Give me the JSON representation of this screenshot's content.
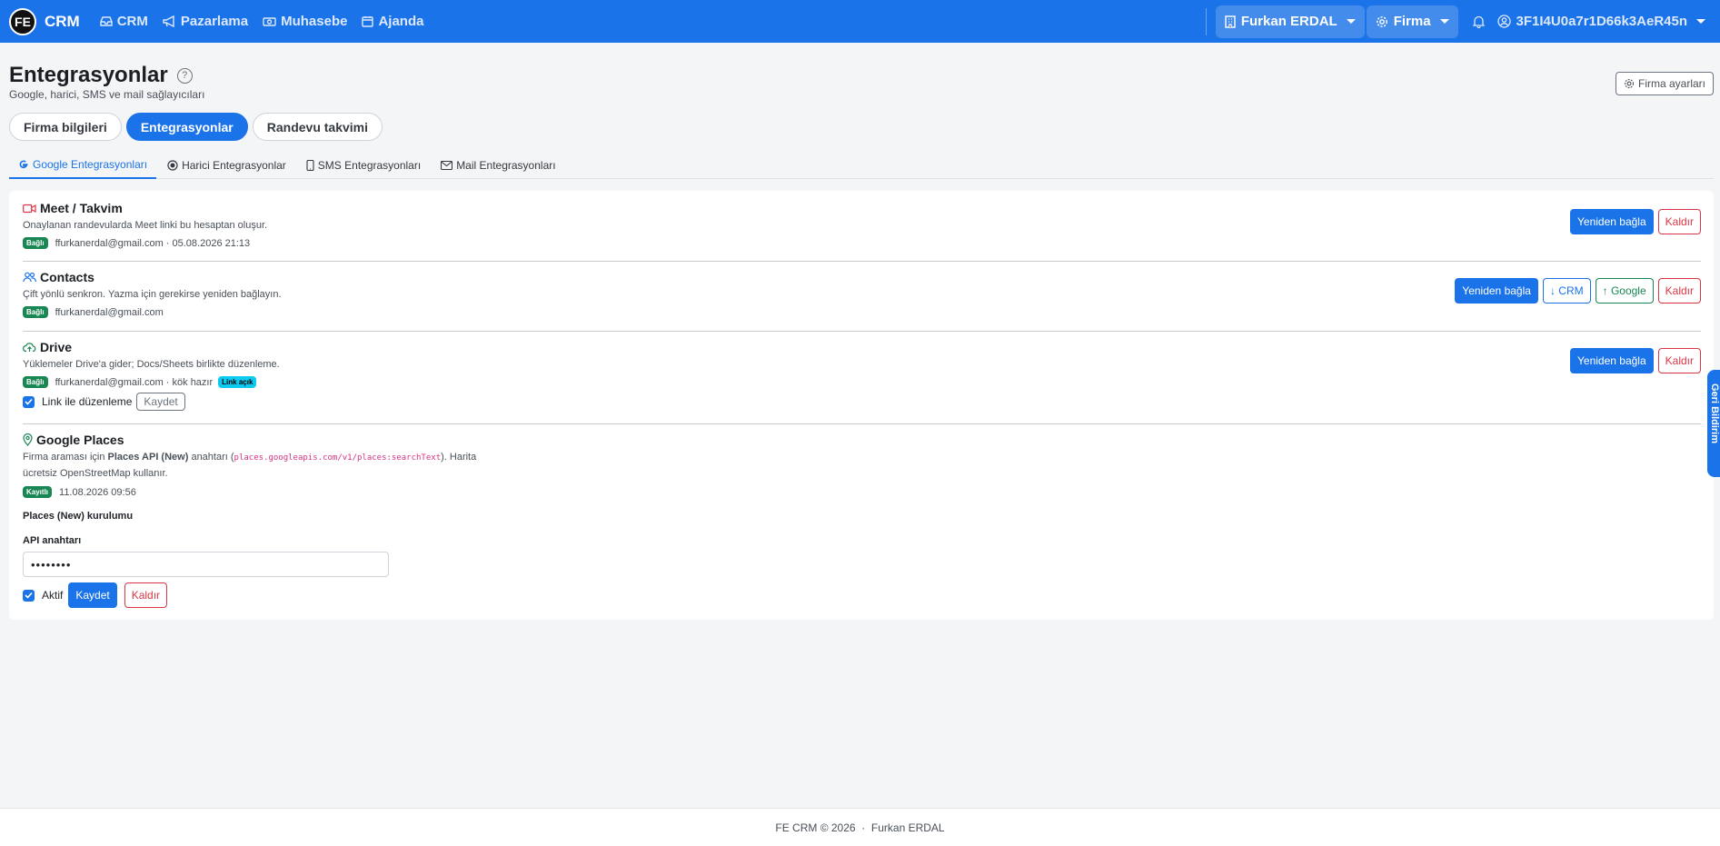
{
  "navbar": {
    "logo_text": "FE",
    "brand": "CRM",
    "links": [
      {
        "label": "CRM",
        "icon": "inbox-icon"
      },
      {
        "label": "Pazarlama",
        "icon": "megaphone-icon"
      },
      {
        "label": "Muhasebe",
        "icon": "cash-icon"
      },
      {
        "label": "Ajanda",
        "icon": "calendar-icon"
      }
    ],
    "user_menu": "Furkan ERDAL",
    "firm_menu": "Firma",
    "account_id": "3F1I4U0a7r1D66k3AeR45n"
  },
  "header": {
    "title": "Entegrasyonlar",
    "help": "?",
    "subtitle": "Google, harici, SMS ve mail sağlayıcıları",
    "settings_button": "Firma ayarları"
  },
  "top_tabs": [
    {
      "label": "Firma bilgileri",
      "active": false
    },
    {
      "label": "Entegrasyonlar",
      "active": true
    },
    {
      "label": "Randevu takvimi",
      "active": false
    }
  ],
  "sub_tabs": [
    {
      "label": "Google Entegrasyonları",
      "active": true
    },
    {
      "label": "Harici Entegrasyonlar",
      "active": false
    },
    {
      "label": "SMS Entegrasyonları",
      "active": false
    },
    {
      "label": "Mail Entegrasyonları",
      "active": false
    }
  ],
  "sections": {
    "meet": {
      "title": "Meet / Takvim",
      "desc": "Onaylanan randevularda Meet linki bu hesaptan oluşur.",
      "badge": "Bağlı",
      "status": "ffurkanerdal@gmail.com · 05.08.2026 21:13",
      "reconnect": "Yeniden bağla",
      "remove": "Kaldır"
    },
    "contacts": {
      "title": "Contacts",
      "desc": "Çift yönlü senkron. Yazma için gerekirse yeniden bağlayın.",
      "badge": "Bağlı",
      "status": "ffurkanerdal@gmail.com",
      "reconnect": "Yeniden bağla",
      "to_crm": "↓ CRM",
      "to_google": "↑ Google",
      "remove": "Kaldır"
    },
    "drive": {
      "title": "Drive",
      "desc": "Yüklemeler Drive'a gider; Docs/Sheets birlikte düzenleme.",
      "badge": "Bağlı",
      "status": "ffurkanerdal@gmail.com · kök hazır",
      "link_badge": "Link açık",
      "checkbox_label": "Link ile düzenleme",
      "save": "Kaydet",
      "reconnect": "Yeniden bağla",
      "remove": "Kaldır"
    },
    "places": {
      "title": "Google Places",
      "desc_1": "Firma araması için ",
      "desc_bold": "Places API (New)",
      "desc_2": " anahtarı (",
      "desc_code": "places.googleapis.com/v1/places:searchText",
      "desc_3": "). Harita",
      "desc_line2": "ücretsiz OpenStreetMap kullanır.",
      "badge": "Kayıtlı",
      "status": "11.08.2026 09:56",
      "setup_title": "Places (New) kurulumu",
      "api_label": "API anahtarı",
      "api_value": "••••••••",
      "active_label": "Aktif",
      "save": "Kaydet",
      "remove": "Kaldır"
    }
  },
  "side_tab": "Geri Bildirim",
  "footer": "FE CRM © 2026  ·  Furkan ERDAL",
  "colors": {
    "primary": "#1a73e8",
    "success": "#198754",
    "danger": "#dc3545",
    "info": "#0dcaf0"
  }
}
